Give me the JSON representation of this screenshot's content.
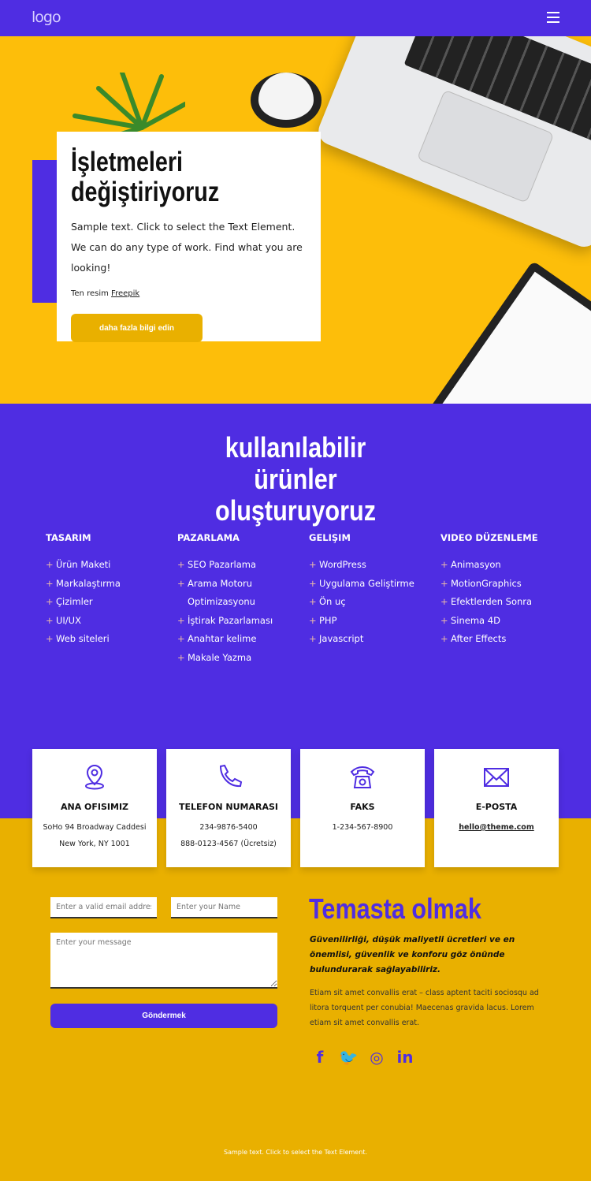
{
  "header": {
    "logo": "logo",
    "menu_icon": "hamburger-icon"
  },
  "hero": {
    "title": "İşletmeleri değiştiriyoruz",
    "text": "Sample text. Click to select the Text Element. We can do any type of work. Find what you are looking!",
    "credit_prefix": "Ten resim",
    "credit_link": "Freepik",
    "button": "daha fazla bilgi edin"
  },
  "services": {
    "title": "kullanılabilir ürünler oluşturuyoruz",
    "columns": [
      {
        "heading": "TASARIM",
        "items": [
          "Ürün Maketi",
          "Markalaştırma",
          "Çizimler",
          "UI/UX",
          "Web siteleri"
        ]
      },
      {
        "heading": "PAZARLAMA",
        "items": [
          "SEO Pazarlama",
          "Arama Motoru Optimizasyonu",
          "İştirak Pazarlaması",
          "Anahtar kelime",
          "Makale Yazma"
        ]
      },
      {
        "heading": "GELIŞIM",
        "items": [
          "WordPress",
          "Uygulama Geliştirme",
          "Ön uç",
          "PHP",
          "Javascript"
        ]
      },
      {
        "heading": "VIDEO DÜZENLEME",
        "items": [
          "Animasyon",
          "MotionGraphics",
          "Efektlerden Sonra",
          "Sinema 4D",
          "After Effects"
        ]
      }
    ]
  },
  "cards": [
    {
      "icon": "map-pin-icon",
      "title": "ANA OFISIMIZ",
      "lines": [
        "SoHo 94 Broadway Caddesi",
        "New York, NY 1001"
      ]
    },
    {
      "icon": "phone-icon",
      "title": "TELEFON NUMARASI",
      "lines": [
        "234-9876-5400",
        "888-0123-4567 (Ücretsiz)"
      ]
    },
    {
      "icon": "telephone-icon",
      "title": "FAKS",
      "lines": [
        "1-234-567-8900"
      ]
    },
    {
      "icon": "mail-icon",
      "title": "E-POSTA",
      "link": "hello@theme.com"
    }
  ],
  "form": {
    "email_placeholder": "Enter a valid email address",
    "name_placeholder": "Enter your Name",
    "message_placeholder": "Enter your message",
    "submit": "Göndermek"
  },
  "contact": {
    "title": "Temasta olmak",
    "lead": "Güvenilirliği, düşük maliyetli ücretleri ve en önemlisi, güvenlik ve konforu göz önünde bulundurarak sağlayabiliriz.",
    "body": "Etiam sit amet convallis erat – class aptent taciti sociosqu ad litora torquent per conubia! Maecenas gravida lacus. Lorem etiam sit amet convallis erat.",
    "social": [
      {
        "icon": "facebook-icon",
        "glyph": "f"
      },
      {
        "icon": "twitter-icon",
        "glyph": "🐦"
      },
      {
        "icon": "instagram-icon",
        "glyph": "◎"
      },
      {
        "icon": "linkedin-icon",
        "glyph": "in"
      }
    ]
  },
  "footer": {
    "text": "Sample text. Click to select the Text Element."
  },
  "colors": {
    "purple": "#4f2de2",
    "hero_yellow": "#fdbe0a",
    "yellow": "#e9b000"
  }
}
